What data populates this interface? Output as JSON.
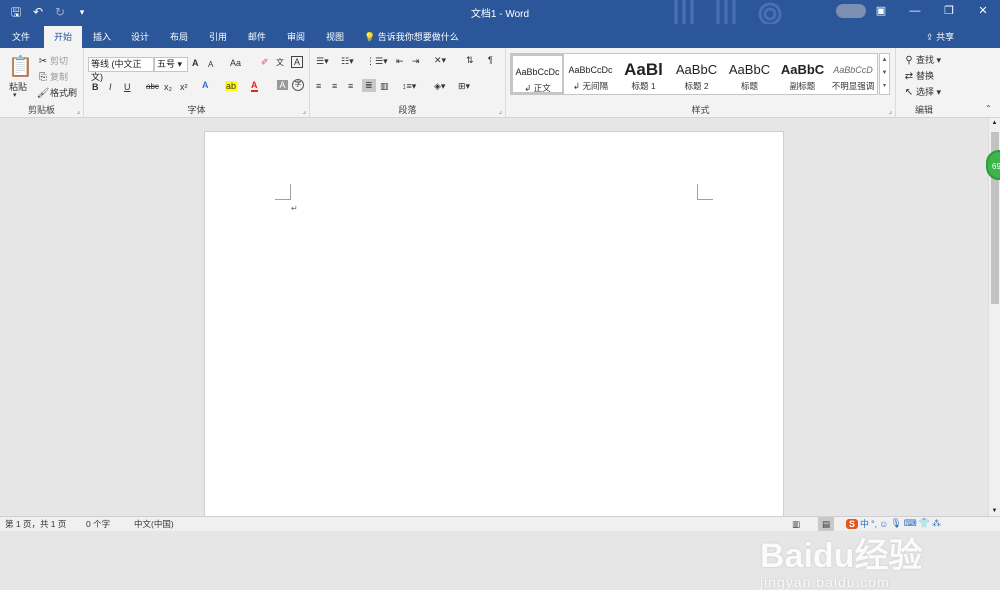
{
  "app": {
    "title": "文档1 - Word"
  },
  "qat": {
    "save_icon": "save-icon",
    "undo_icon": "undo-icon",
    "redo_icon": "redo-icon",
    "customize_icon": "customize-icon"
  },
  "window": {
    "minimize": "—",
    "restore": "❐",
    "close": "✕"
  },
  "tabs": [
    {
      "label": "文件"
    },
    {
      "label": "开始"
    },
    {
      "label": "插入"
    },
    {
      "label": "设计"
    },
    {
      "label": "布局"
    },
    {
      "label": "引用"
    },
    {
      "label": "邮件"
    },
    {
      "label": "审阅"
    },
    {
      "label": "视图"
    }
  ],
  "tellme": "告诉我你想要做什么",
  "share": "共享",
  "clipboard": {
    "paste": "粘贴",
    "cut": "剪切",
    "copy": "复制",
    "format_painter": "格式刷",
    "group": "剪贴板"
  },
  "font": {
    "name": "等线 (中文正文)",
    "size": "五号",
    "group": "字体",
    "bold": "B",
    "italic": "I",
    "underline": "U",
    "strike": "abc",
    "subscript": "x₂",
    "superscript": "x²",
    "grow": "A",
    "shrink": "A",
    "change_case": "Aa",
    "font_color_letter": "A",
    "highlight": "ab"
  },
  "paragraph": {
    "group": "段落"
  },
  "styles": {
    "group": "样式",
    "items": [
      {
        "preview": "AaBbCcDc",
        "name": "↲ 正文"
      },
      {
        "preview": "AaBbCcDc",
        "name": "↲ 无间隔"
      },
      {
        "preview": "AaBl",
        "name": "标题 1"
      },
      {
        "preview": "AaBbC",
        "name": "标题 2"
      },
      {
        "preview": "AaBbC",
        "name": "标题"
      },
      {
        "preview": "AaBbC",
        "name": "副标题"
      },
      {
        "preview": "AaBbCcD",
        "name": "不明显强调"
      }
    ]
  },
  "editing": {
    "find": "查找",
    "replace": "替换",
    "select": "选择",
    "group": "编辑"
  },
  "document": {
    "paragraph_mark": "↵"
  },
  "status": {
    "page": "第 1 页，共 1 页",
    "words": "0 个字",
    "language": "中文(中国)"
  },
  "badge": {
    "text": "69"
  },
  "ime": {
    "s": "S",
    "zh": "中",
    "dots": "°,"
  },
  "watermark": {
    "brand": "Baidu经验",
    "url": "jingyan.baidu.com"
  },
  "colors": {
    "accent": "#2b579a",
    "font_color": "#e8231b",
    "highlight": "#ffff00"
  }
}
